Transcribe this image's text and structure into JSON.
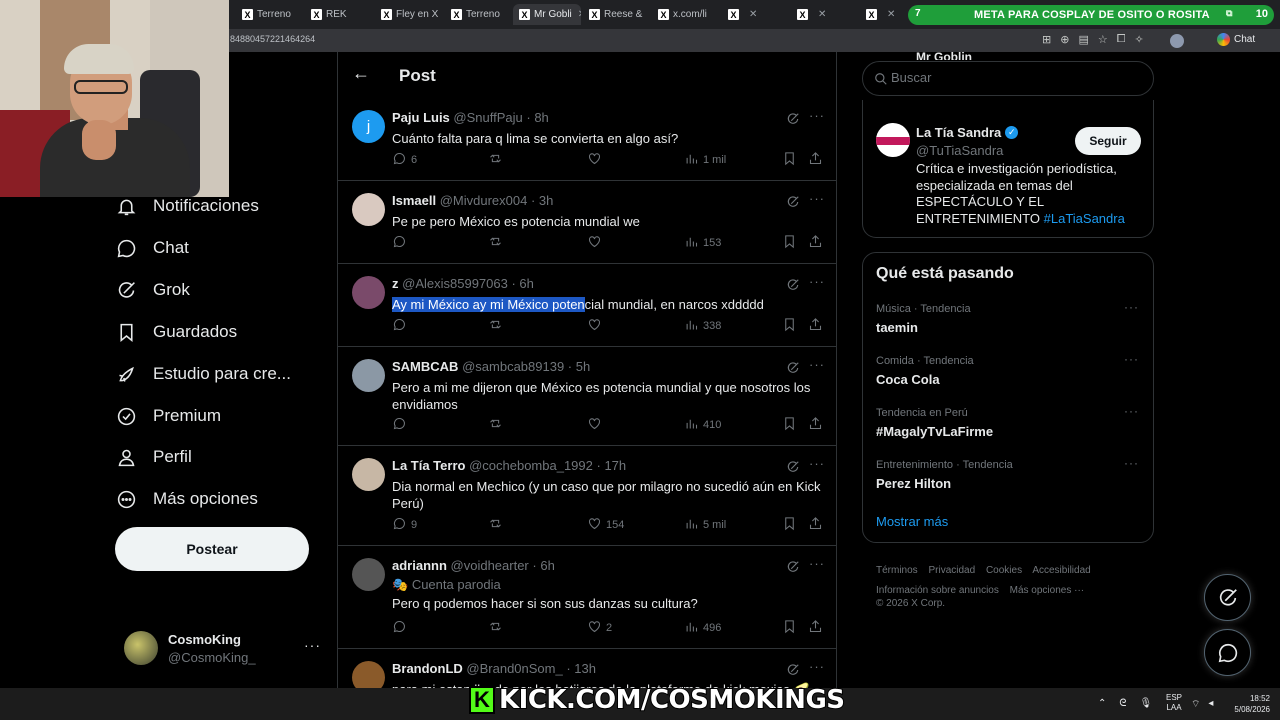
{
  "browser": {
    "tabs": [
      {
        "label": "Terreno",
        "active": false
      },
      {
        "label": "REK",
        "active": false
      },
      {
        "label": "Fley en X",
        "active": false
      },
      {
        "label": "Terreno",
        "active": false
      },
      {
        "label": "Mr Gobli",
        "active": true
      },
      {
        "label": "Reese &",
        "active": false
      },
      {
        "label": "x.com/li",
        "active": false
      },
      {
        "label": "X",
        "active": false
      },
      {
        "label": "X",
        "active": false
      },
      {
        "label": "X",
        "active": false
      }
    ],
    "url_fragment": "84880457221464264",
    "chat_label": "Chat"
  },
  "stream_banner": {
    "left_value": "7",
    "text": "META PARA COSPLAY DE OSITO O ROSITA",
    "right_value": "10"
  },
  "nav": {
    "items": [
      {
        "label": "Notificaciones",
        "icon": "bell-icon"
      },
      {
        "label": "Chat",
        "icon": "chat-bubble-icon"
      },
      {
        "label": "Grok",
        "icon": "grok-icon"
      },
      {
        "label": "Guardados",
        "icon": "bookmark-icon"
      },
      {
        "label": "Estudio para cre...",
        "icon": "rocket-icon"
      },
      {
        "label": "Premium",
        "icon": "verified-badge-icon"
      },
      {
        "label": "Perfil",
        "icon": "person-icon"
      },
      {
        "label": "Más opciones",
        "icon": "more-circle-icon"
      }
    ],
    "post_button": "Postear",
    "profile": {
      "name": "CosmoKing",
      "handle": "@CosmoKing_"
    }
  },
  "main": {
    "header_title": "Post",
    "replies": [
      {
        "name": "Paju Luis",
        "handle": "@SnuffPaju",
        "time": "8h",
        "text": "Cuánto falta para q lima se convierta en algo así?",
        "replies": "6",
        "reposts": "",
        "likes": "",
        "views": "1 mil",
        "avatar_color": "#1d9bf0"
      },
      {
        "name": "Ismaell",
        "handle": "@Mivdurex004",
        "time": "3h",
        "text": "Pe pe pero México es potencia mundial we",
        "replies": "",
        "reposts": "",
        "likes": "",
        "views": "153",
        "avatar_color": "#d9c9c0"
      },
      {
        "name": "z",
        "handle": "@Alexis85997063",
        "time": "6h",
        "text_highlight": "Ay mi México ay mi México poten",
        "text_rest": "cial mundial, en narcos xddddd",
        "replies": "",
        "reposts": "",
        "likes": "",
        "views": "338",
        "avatar_color": "#7a4a6a"
      },
      {
        "name": "SAMBCAB",
        "handle": "@sambcab89139",
        "time": "5h",
        "text": "Pero a mi me dijeron que México es potencia mundial y que nosotros los envidiamos",
        "replies": "",
        "reposts": "",
        "likes": "",
        "views": "410",
        "avatar_color": "#8b98a5"
      },
      {
        "name": "La Tía Terro",
        "handle": "@cochebomba_1992",
        "time": "17h",
        "text": "Dia normal en Mechico (y un caso que por milagro no sucedió aún en Kick Perú)",
        "replies": "9",
        "reposts": "",
        "likes": "154",
        "views": "5 mil",
        "avatar_color": "#c7b7a5"
      },
      {
        "name": "adriannn",
        "handle": "@voidhearter",
        "time": "6h",
        "parody": "Cuenta parodia",
        "text": "Pero q podemos hacer si son sus danzas su cultura?",
        "replies": "",
        "reposts": "",
        "likes": "2",
        "views": "496",
        "avatar_color": "#555"
      },
      {
        "name": "BrandonLD",
        "handle": "@Brand0nSom_",
        "time": "13h",
        "text": "para mi estan llendo por los botijeros de la plataforma de kick mexico 🥑",
        "replies": "",
        "reposts": "",
        "likes": "",
        "views": "",
        "avatar_color": "#8a5a2a"
      }
    ]
  },
  "right": {
    "search_placeholder": "Buscar",
    "top_partial": "Mr Goblin",
    "who_to_follow": {
      "name": "La Tía Sandra",
      "handle": "@TuTiaSandra",
      "follow_label": "Seguir",
      "bio": "Crítica e investigación periodística, especializada en temas del ESPECTÁCULO Y EL ENTRETENIMIENTO",
      "bio_tag": "#LaTiaSandra"
    },
    "trends_title": "Qué está pasando",
    "trends": [
      {
        "category": "Música · Tendencia",
        "name": "taemin"
      },
      {
        "category": "Comida · Tendencia",
        "name": "Coca Cola"
      },
      {
        "category": "Tendencia en Perú",
        "name": "#MagalyTvLaFirme"
      },
      {
        "category": "Entretenimiento · Tendencia",
        "name": "Perez Hilton"
      }
    ],
    "show_more": "Mostrar más",
    "footer": [
      "Términos",
      "Privacidad",
      "Cookies",
      "Accesibilidad",
      "Información sobre anuncios",
      "Más opciones ···"
    ],
    "copyright": "© 2026 X Corp."
  },
  "taskbar": {
    "lang": "ESP",
    "lang2": "LAA",
    "time": "18:52",
    "date": "5/08/2026"
  },
  "overlay": {
    "kick_letter": "K",
    "kick_text": "KICK.COM/COSMOKINGS"
  },
  "colors": {
    "accent": "#1d9bf0",
    "banner": "#1f9e3a",
    "kick_green": "#53fc18"
  }
}
